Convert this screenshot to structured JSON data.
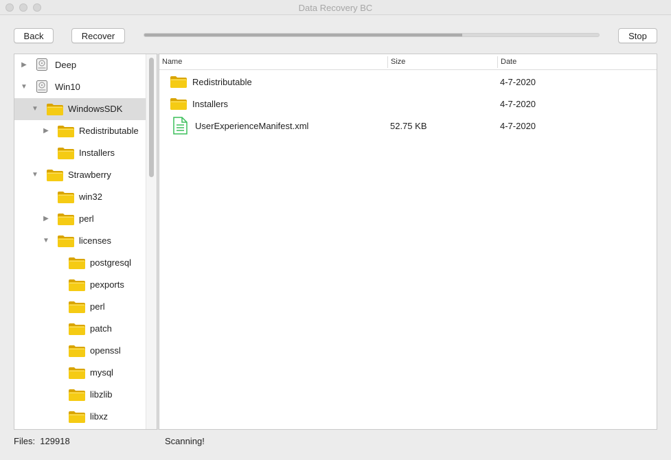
{
  "window": {
    "title": "Data Recovery BC"
  },
  "toolbar": {
    "back_label": "Back",
    "recover_label": "Recover",
    "stop_label": "Stop",
    "scan_progress_percent": 70
  },
  "tree": {
    "items": [
      {
        "label": "Deep",
        "icon": "hard-drive-icon",
        "expanded": false,
        "selected": false
      },
      {
        "label": "Win10",
        "icon": "hard-drive-icon",
        "expanded": true,
        "selected": false
      },
      {
        "label": "WindowsSDK",
        "icon": "folder-icon",
        "expanded": true,
        "selected": true
      },
      {
        "label": "Redistributable",
        "icon": "folder-icon",
        "expanded": false,
        "selected": false
      },
      {
        "label": "Installers",
        "icon": "folder-icon",
        "selected": false
      },
      {
        "label": "Strawberry",
        "icon": "folder-icon",
        "expanded": true,
        "selected": false
      },
      {
        "label": "win32",
        "icon": "folder-icon",
        "selected": false
      },
      {
        "label": "perl",
        "icon": "folder-icon",
        "expanded": false,
        "selected": false
      },
      {
        "label": "licenses",
        "icon": "folder-icon",
        "expanded": true,
        "selected": false
      },
      {
        "label": "postgresql",
        "icon": "folder-icon",
        "selected": false
      },
      {
        "label": "pexports",
        "icon": "folder-icon",
        "selected": false
      },
      {
        "label": "perl",
        "icon": "folder-icon",
        "selected": false
      },
      {
        "label": "patch",
        "icon": "folder-icon",
        "selected": false
      },
      {
        "label": "openssl",
        "icon": "folder-icon",
        "selected": false
      },
      {
        "label": "mysql",
        "icon": "folder-icon",
        "selected": false
      },
      {
        "label": "libzlib",
        "icon": "folder-icon",
        "selected": false
      },
      {
        "label": "libxz",
        "icon": "folder-icon",
        "selected": false
      }
    ]
  },
  "list": {
    "columns": {
      "name": "Name",
      "size": "Size",
      "date": "Date"
    },
    "rows": [
      {
        "name": "Redistributable",
        "size": "",
        "date": "4-7-2020",
        "icon": "folder-icon"
      },
      {
        "name": "Installers",
        "size": "",
        "date": "4-7-2020",
        "icon": "folder-icon"
      },
      {
        "name": "UserExperienceManifest.xml",
        "size": "52.75 KB",
        "date": "4-7-2020",
        "icon": "document-icon"
      }
    ]
  },
  "status": {
    "files_label": "Files:",
    "files_count": "129918",
    "message": "Scanning!"
  },
  "colors": {
    "folder": "#f1c40f",
    "document": "#3bbf5a",
    "selection": "#dcdcdc"
  }
}
